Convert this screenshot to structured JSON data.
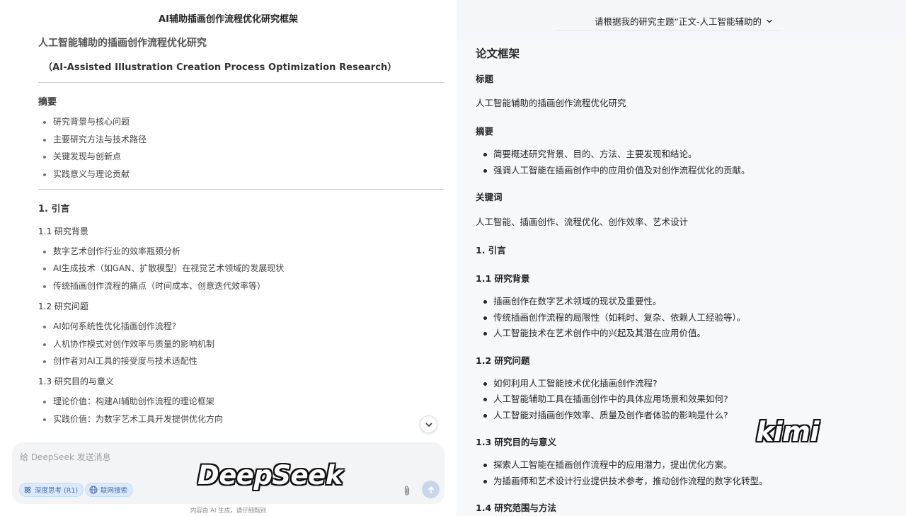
{
  "left": {
    "top_title": "AI辅助插画创作流程优化研究框架",
    "h1": "人工智能辅助的插画创作流程优化研究",
    "subtitle": "（AI-Assisted Illustration Creation Process Optimization Research）",
    "abstract_heading": "摘要",
    "abstract_items": [
      "研究背景与核心问题",
      "主要研究方法与技术路径",
      "关键发现与创新点",
      "实践意义与理论贡献"
    ],
    "section1": "1. 引言",
    "s11": "1.1 研究背景",
    "s11_items": [
      "数字艺术创作行业的效率瓶颈分析",
      "AI生成技术（如GAN、扩散模型）在视觉艺术领域的发展现状",
      "传统插画创作流程的痛点（时间成本、创意迭代效率等）"
    ],
    "s12": "1.2 研究问题",
    "s12_items": [
      "AI如何系统性优化插画创作流程?",
      "人机协作模式对创作效率与质量的影响机制",
      "创作者对AI工具的接受度与技术适配性"
    ],
    "s13": "1.3 研究目的与意义",
    "s13_items": [
      "理论价值：构建AI辅助创作流程的理论框架",
      "实践价值：为数字艺术工具开发提供优化方向"
    ],
    "input_placeholder": "给 DeepSeek 发送消息",
    "chip_deep": "深度思考 (R1)",
    "chip_search": "联网搜索",
    "logo": "DeepSeek",
    "footnote": "内容由 AI 生成，请仔细甄别",
    "icons": [
      "chevron-down-icon",
      "atom-icon",
      "globe-icon",
      "paperclip-icon",
      "arrow-up-icon"
    ]
  },
  "right": {
    "top_title": "请根据我的研究主题“正文-人工智能辅助的",
    "h1": "论文框架",
    "title_heading": "标题",
    "title_text": "人工智能辅助的插画创作流程优化研究",
    "abstract_heading": "摘要",
    "abstract_items": [
      "简要概述研究背景、目的、方法、主要发现和结论。",
      "强调人工智能在插画创作中的应用价值及对创作流程优化的贡献。"
    ],
    "keywords_heading": "关键词",
    "keywords_text": "人工智能、插画创作、流程优化、创作效率、艺术设计",
    "section1": "1. 引言",
    "s11": "1.1 研究背景",
    "s11_items": [
      "插画创作在数字艺术领域的现状及重要性。",
      "传统插画创作流程的局限性（如耗时、复杂、依赖人工经验等）。",
      "人工智能技术在艺术创作中的兴起及其潜在应用价值。"
    ],
    "s12": "1.2 研究问题",
    "s12_items": [
      "如何利用人工智能技术优化插画创作流程?",
      "人工智能辅助工具在插画创作中的具体应用场景和效果如何?",
      "人工智能对插画创作效率、质量及创作者体验的影响是什么?"
    ],
    "s13": "1.3 研究目的与意义",
    "s13_items": [
      "探索人工智能在插画创作流程中的应用潜力，提出优化方案。",
      "为插画师和艺术设计行业提供技术参考，推动创作流程的数字化转型。"
    ],
    "s14": "1.4 研究范围与方法",
    "logo": "kimi"
  }
}
